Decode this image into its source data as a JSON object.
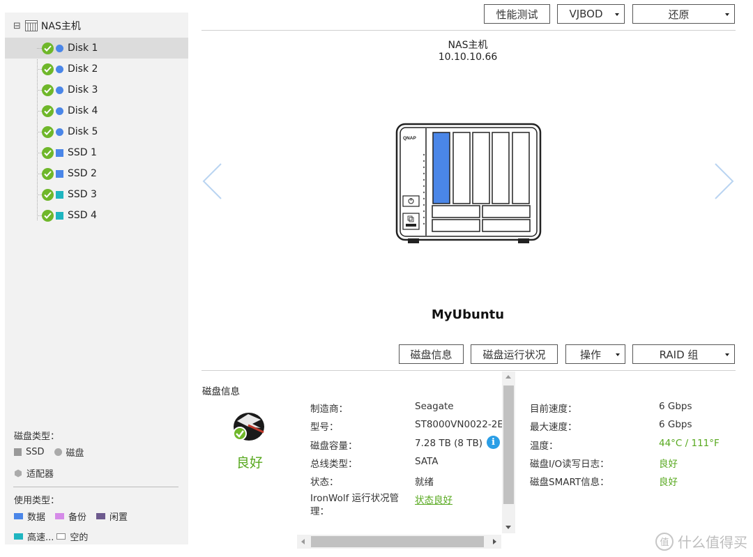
{
  "colors": {
    "accent_blue": "#4a86e8",
    "teal": "#1fb5c0",
    "status_green": "#6fb72a",
    "good_text_green": "#57a81e",
    "data_type": "#4a86e8",
    "backup_type": "#d58be8",
    "idle_type": "#6d5a8e",
    "cache_type": "#1fb5c0"
  },
  "tree": {
    "root_label": "NAS主机",
    "root_toggle": "⊟",
    "items": [
      {
        "label": "Disk 1",
        "kind": "disk",
        "color": "#4a86e8",
        "selected": true
      },
      {
        "label": "Disk 2",
        "kind": "disk",
        "color": "#4a86e8",
        "selected": false
      },
      {
        "label": "Disk 3",
        "kind": "disk",
        "color": "#4a86e8",
        "selected": false
      },
      {
        "label": "Disk 4",
        "kind": "disk",
        "color": "#4a86e8",
        "selected": false
      },
      {
        "label": "Disk 5",
        "kind": "disk",
        "color": "#4a86e8",
        "selected": false
      },
      {
        "label": "SSD 1",
        "kind": "ssd",
        "color": "#4a86e8",
        "selected": false
      },
      {
        "label": "SSD 2",
        "kind": "ssd",
        "color": "#4a86e8",
        "selected": false
      },
      {
        "label": "SSD 3",
        "kind": "ssd",
        "color": "#1fb5c0",
        "selected": false
      },
      {
        "label": "SSD 4",
        "kind": "ssd",
        "color": "#1fb5c0",
        "selected": false
      }
    ]
  },
  "legend": {
    "disk_type_title": "磁盘类型：",
    "ssd_label": "SSD",
    "disk_label": "磁盘",
    "adapter_label": "适配器",
    "usage_type_title": "使用类型：",
    "data_label": "数据",
    "backup_label": "备份",
    "idle_label": "闲置",
    "cache_label": "高速...",
    "empty_label": "空的"
  },
  "toolbar": {
    "perf_test": "性能测试",
    "vjbod": "VJBOD",
    "restore": "还原"
  },
  "device": {
    "name": "NAS主机",
    "ip": "10.10.10.66",
    "brand_mark": "QNAP",
    "vm_name": "MyUbuntu"
  },
  "disk_toolbar": {
    "disk_info": "磁盘信息",
    "disk_health": "磁盘运行状况",
    "operation": "操作",
    "raid_group": "RAID 组"
  },
  "info_panel": {
    "title": "磁盘信息",
    "health_status": "良好",
    "left_fields": [
      {
        "label": "制造商：",
        "value": "Seagate"
      },
      {
        "label": "型号：",
        "value": "ST8000VN0022-2E."
      },
      {
        "label": "磁盘容量：",
        "value": "7.28 TB (8 TB)"
      },
      {
        "label": "总线类型：",
        "value": "SATA"
      },
      {
        "label": "状态：",
        "value": "就绪"
      }
    ],
    "ironwolf_label": "IronWolf 运行状况管理：",
    "ironwolf_value": "状态良好",
    "info_icon": "i",
    "right_fields": [
      {
        "label": "目前速度：",
        "value": "6 Gbps"
      },
      {
        "label": "最大速度：",
        "value": "6 Gbps"
      },
      {
        "label": "温度：",
        "value": "44°C / 111°F"
      },
      {
        "label": "磁盘I/O读写日志：",
        "value": "良好"
      },
      {
        "label": "磁盘SMART信息：",
        "value": "良好"
      }
    ]
  },
  "watermark": {
    "glyph": "值",
    "text": "什么值得买"
  }
}
